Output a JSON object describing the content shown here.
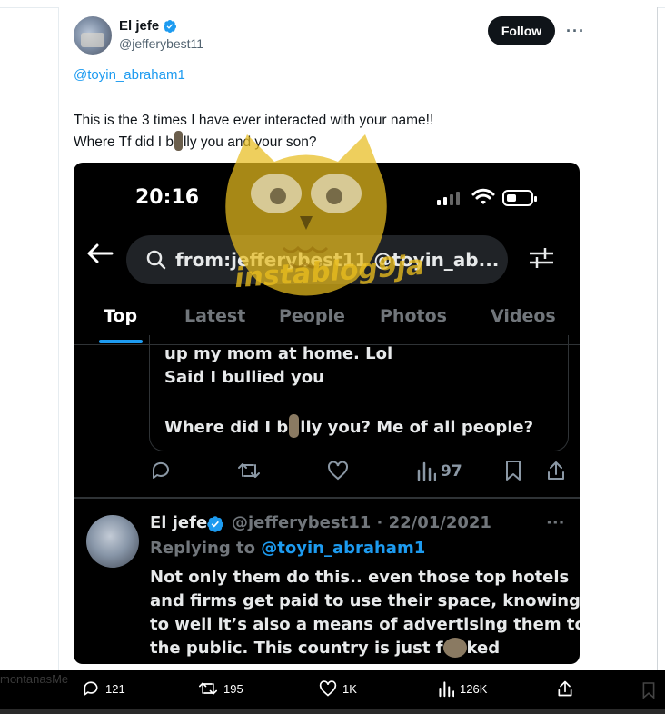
{
  "tweet": {
    "display_name": "El jefe",
    "handle": "@jefferybest11",
    "follow_label": "Follow",
    "more_label": "···",
    "mention": "@toyin_abraham1",
    "line1": "This is the 3 times I have ever interacted with your name!!",
    "line2_a": "Where Tf did I b",
    "line2_b": "lly you and your son?"
  },
  "screenshot": {
    "time": "20:16",
    "search_query": "from:jefferybest11 @toyin_ab...",
    "tabs": [
      "Top",
      "Latest",
      "People",
      "Photos",
      "Videos"
    ],
    "active_tab": "Top",
    "quoted_lines": [
      "up my mom at home. Lol",
      "Said I bullied you",
      "Where did I b",
      "lly you? Me of all people?"
    ],
    "views_count": "97",
    "reply": {
      "name": "El jefe",
      "meta": "@jefferybest11 · 22/01/2021",
      "more_label": "···",
      "replying_prefix": "Replying to",
      "replying_handle": "@toyin_abraham1",
      "body_lines": [
        "Not only them do this.. even those top hotels",
        "and firms get paid to use their space, knowing",
        "to well it’s also a means of advertising them to",
        "the public. This country is just f",
        "ked"
      ]
    }
  },
  "watermark": "instablog9ja",
  "bottom_bar": {
    "replies": "121",
    "reposts": "195",
    "likes": "1K",
    "views": "126K",
    "ghost_text": "montanasMe"
  },
  "colors": {
    "accent": "#1d9bf0",
    "dark_bg": "#000000",
    "watermark": "#e8bc1e"
  }
}
